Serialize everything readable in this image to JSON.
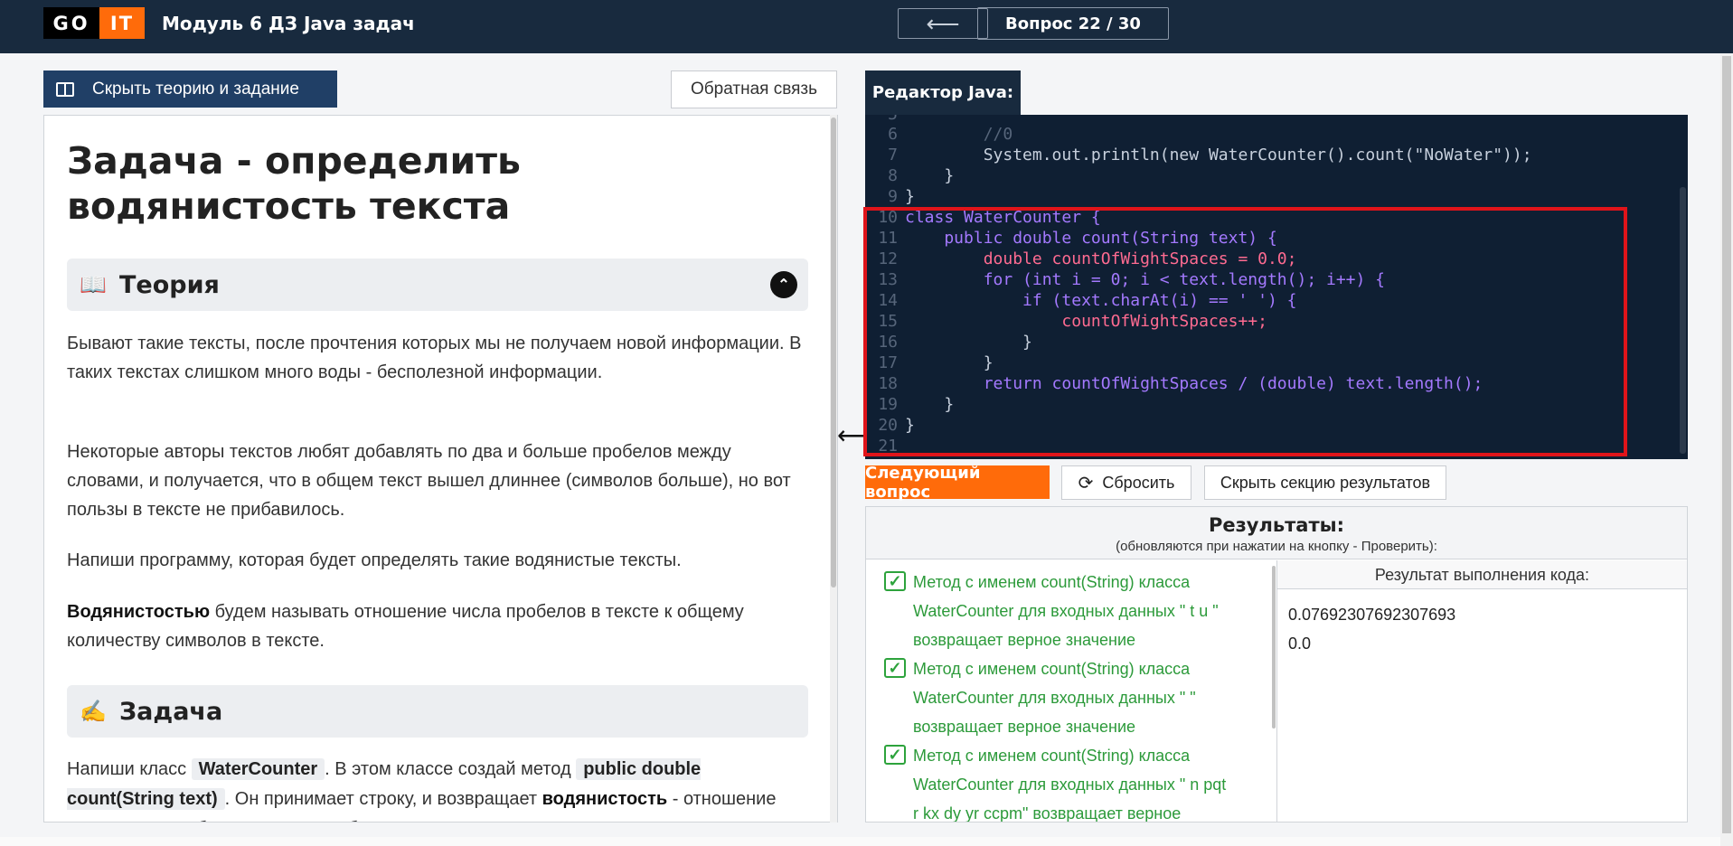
{
  "header": {
    "logo_left": "GO",
    "logo_right": "IT",
    "app_title": "Модуль 6 ДЗ Java задач",
    "back_arrow": "⟵",
    "question_counter": "Вопрос 22 / 30"
  },
  "left_toolbar": {
    "hide_theory_label": "Скрыть теорию и задание",
    "feedback_label": "Обратная связь"
  },
  "task": {
    "title": "Задача - определить водянистость текста",
    "theory_section": {
      "icon": "open-book-icon",
      "title": "Теория",
      "toggle": "⌃"
    },
    "paragraphs": [
      "Бывают такие тексты, после прочтения которых мы не получаем новой информации. В таких текстах слишком много воды - бесполезной информации.",
      "Некоторые авторы текстов любят добавлять по два и больше пробелов между словами, и получается, что в общем текст вышел длиннее (символов больше), но вот пользы в тексте не прибавилось.",
      "Напиши программу, которая будет определять такие водянистые тексты."
    ],
    "definition": {
      "bold": "Водянистостью",
      "rest": " будем называть отношение числа пробелов в тексте к общему количеству символов в тексте."
    },
    "task_section": {
      "icon": "writing-hand-icon",
      "title": "Задача"
    },
    "task_text": {
      "part1": "Напиши класс",
      "code1": "WaterCounter",
      "part2": ". В этом классе создай метод",
      "code2": "public double count(String text)",
      "part3": ". Он принимает строку, и возвращает",
      "bold": "водянистость",
      "part4": " - отношение количества пробелов в тексте к общему количеству символов в"
    }
  },
  "editor": {
    "tab_label": "Редактор Java:",
    "partial_top_line": "5",
    "lines": [
      {
        "n": "6",
        "code": "        //0"
      },
      {
        "n": "7",
        "code": "        System.out.println(new WaterCounter().count(\"NoWater\"));"
      },
      {
        "n": "8",
        "code": "    }"
      },
      {
        "n": "9",
        "code": "}"
      },
      {
        "n": "10",
        "code": "class WaterCounter {"
      },
      {
        "n": "11",
        "code": "    public double count(String text) {"
      },
      {
        "n": "12",
        "code": "        double countOfWightSpaces = 0.0;"
      },
      {
        "n": "13",
        "code": "        for (int i = 0; i < text.length(); i++) {"
      },
      {
        "n": "14",
        "code": "            if (text.charAt(i) == ' ') {"
      },
      {
        "n": "15",
        "code": "                countOfWightSpaces++;"
      },
      {
        "n": "16",
        "code": "            }"
      },
      {
        "n": "17",
        "code": "        }"
      },
      {
        "n": "18",
        "code": "        return countOfWightSpaces / (double) text.length();"
      },
      {
        "n": "19",
        "code": "    }"
      },
      {
        "n": "20",
        "code": "}"
      },
      {
        "n": "21",
        "code": ""
      }
    ]
  },
  "actions": {
    "next_question": "Следующий вопрос",
    "reset": "Сбросить",
    "hide_results": "Скрыть секцию результатов"
  },
  "results": {
    "title": "Результаты:",
    "subtitle": "(обновляются при нажатии на кнопку - Проверить):",
    "output_header": "Результат выполнения кода:",
    "tests": [
      {
        "line1": "Метод с именем count(String) класса",
        "line2": "WaterCounter для входных данных \" t u \"",
        "line3": "возвращает верное значение"
      },
      {
        "line1": "Метод с именем count(String) класса",
        "line2": "WaterCounter для входных данных \"  \"",
        "line3": "возвращает верное значение"
      },
      {
        "line1": "Метод с именем count(String) класса",
        "line2": "WaterCounter для входных данных \" n pqt",
        "line3": "r kx dy yr ccpm\" возвращает верное"
      }
    ],
    "outputs": [
      "0.07692307692307693",
      "0.0"
    ]
  },
  "colors": {
    "header_bg": "#182a3e",
    "accent_orange": "#ff6b0a",
    "hide_btn_bg": "#203f66",
    "editor_bg": "#0f1f33",
    "highlight_red": "#e0141a",
    "pass_green": "#2c9a3a"
  }
}
